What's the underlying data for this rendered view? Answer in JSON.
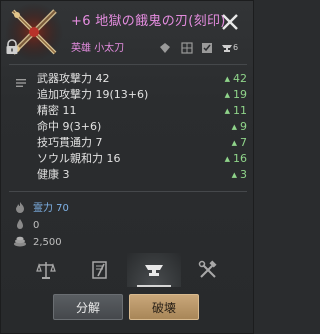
{
  "item": {
    "title": "+6 地獄の餓鬼の刃(刻印)",
    "grade": "英雄",
    "type": "小太刀",
    "header_count": "6",
    "colors": {
      "title": "#e58de0",
      "stat_value": "#8fd48a",
      "spirit": "#7fb3e8"
    }
  },
  "stats": [
    {
      "label": "武器攻撃力 42",
      "value": "42"
    },
    {
      "label": "追加攻撃力 19(13+6)",
      "value": "19"
    },
    {
      "label": "精密 11",
      "value": "11"
    },
    {
      "label": "命中 9(3+6)",
      "value": "9"
    },
    {
      "label": "技巧貫通力 7",
      "value": "7"
    },
    {
      "label": "ソウル親和力 16",
      "value": "16"
    },
    {
      "label": "健康 3",
      "value": "3"
    }
  ],
  "resources": {
    "spirit": "霊力 70",
    "weight": "0",
    "price": "2,500"
  },
  "tabs": [
    "scale-icon",
    "ledger-icon",
    "anvil-icon",
    "hammer-wrench-icon"
  ],
  "buttons": {
    "decompose": "分解",
    "destroy": "破壊"
  }
}
